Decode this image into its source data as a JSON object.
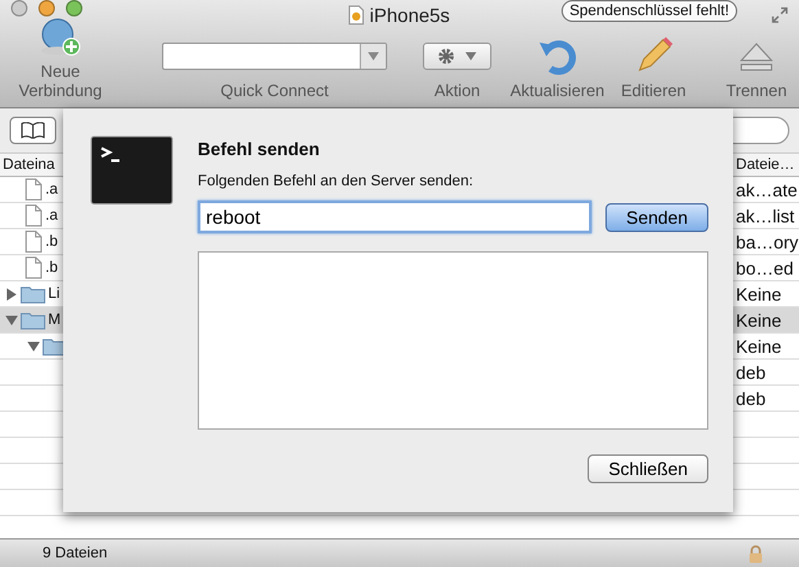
{
  "window": {
    "title": "iPhone5s",
    "badge": "Spendenschlüssel fehlt!"
  },
  "toolbar": {
    "new_connection": "Neue Verbindung",
    "quick_connect": {
      "label": "Quick Connect"
    },
    "action": "Aktion",
    "refresh": "Aktualisieren",
    "edit": "Editieren",
    "disconnect": "Trennen"
  },
  "file_list": {
    "columns": [
      "Dateina",
      "Dateie…"
    ],
    "rows": [
      {
        "name": ".a",
        "kind": "file",
        "type_text": "ak…ate",
        "selected": false
      },
      {
        "name": ".a",
        "kind": "file",
        "type_text": "ak…list",
        "selected": false
      },
      {
        "name": ".b",
        "kind": "file",
        "type_text": "ba…ory",
        "selected": false
      },
      {
        "name": ".b",
        "kind": "file",
        "type_text": "bo…ed",
        "selected": false
      },
      {
        "name": "Li",
        "kind": "folder",
        "expanded": false,
        "type_text": "Keine",
        "selected": false
      },
      {
        "name": "M",
        "kind": "folder",
        "expanded": true,
        "type_text": "Keine",
        "selected": true,
        "children": [
          {
            "kind": "folder",
            "expanded": true,
            "type_text": "Keine",
            "selected": false,
            "children": [
              {
                "type_text": "deb",
                "selected": false
              },
              {
                "type_text": "deb",
                "selected": false
              }
            ]
          }
        ]
      }
    ]
  },
  "sheet": {
    "title": "Befehl senden",
    "prompt": "Folgenden Befehl an den Server senden:",
    "command": "reboot",
    "send_button": "Senden",
    "close_button": "Schließen"
  },
  "status_bar": {
    "text": "9 Dateien"
  }
}
